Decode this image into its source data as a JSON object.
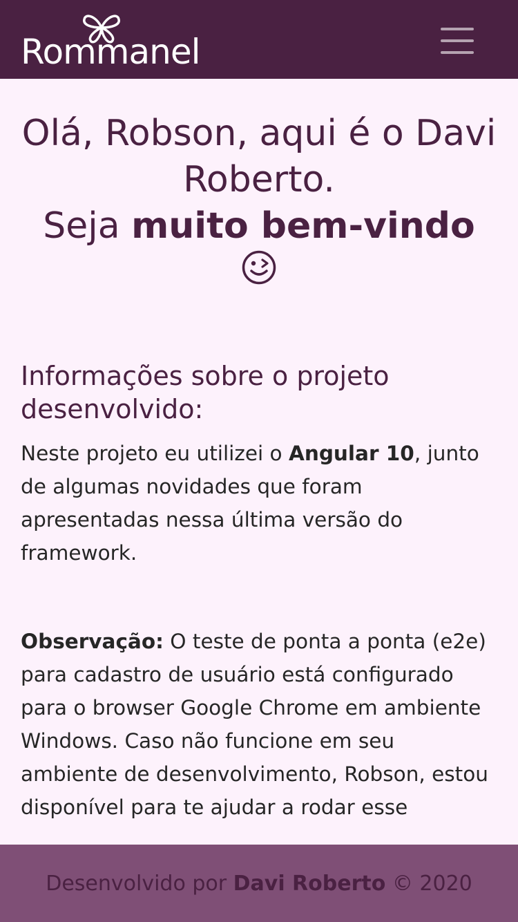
{
  "header": {
    "logo_text": "Rommanel",
    "menu_icon": "hamburger-menu-icon"
  },
  "welcome": {
    "line1": "Olá, Robson, aqui é o Davi Roberto.",
    "line2_prefix": "Seja ",
    "line2_bold": "muito bem-vindo",
    "emoji_icon": "winking-face-icon"
  },
  "project_info": {
    "title": "Informações sobre o projeto desenvolvido:",
    "p1_before": "Neste projeto eu utilizei o ",
    "p1_bold": "Angular 10",
    "p1_after": ", junto de algumas novidades que foram apresentadas nessa última versão do framework.",
    "note_label": "Observação:",
    "note_text": " O teste de ponta a ponta (e2e) para cadastro de usuário está configurado para o browser Google Chrome em ambiente Windows. Caso não funcione em seu ambiente de desenvolvimento, Robson, estou disponível para te ajudar a rodar esse"
  },
  "footer": {
    "prefix": "Desenvolvido por ",
    "author": "Davi Roberto",
    "suffix": " © 2020"
  },
  "colors": {
    "header_bg": "#4a2142",
    "page_bg": "#fdf2fc",
    "accent_text": "#4a2142",
    "footer_bg": "#7f4f76"
  }
}
